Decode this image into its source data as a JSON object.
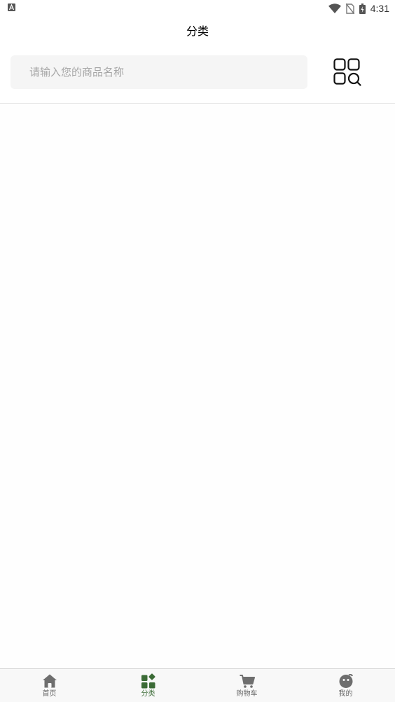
{
  "status_bar": {
    "time": "4:31"
  },
  "header": {
    "title": "分类"
  },
  "search": {
    "placeholder": "请输入您的商品名称",
    "value": ""
  },
  "tab_bar": {
    "items": [
      {
        "label": "首页",
        "icon": "home-icon",
        "active": false
      },
      {
        "label": "分类",
        "icon": "category-icon",
        "active": true
      },
      {
        "label": "购物车",
        "icon": "cart-icon",
        "active": false
      },
      {
        "label": "我的",
        "icon": "profile-icon",
        "active": false
      }
    ]
  },
  "colors": {
    "active_tab": "#3b6b36",
    "inactive_tab": "#666666",
    "search_background": "#f5f5f5",
    "placeholder": "#a6a6a6"
  }
}
